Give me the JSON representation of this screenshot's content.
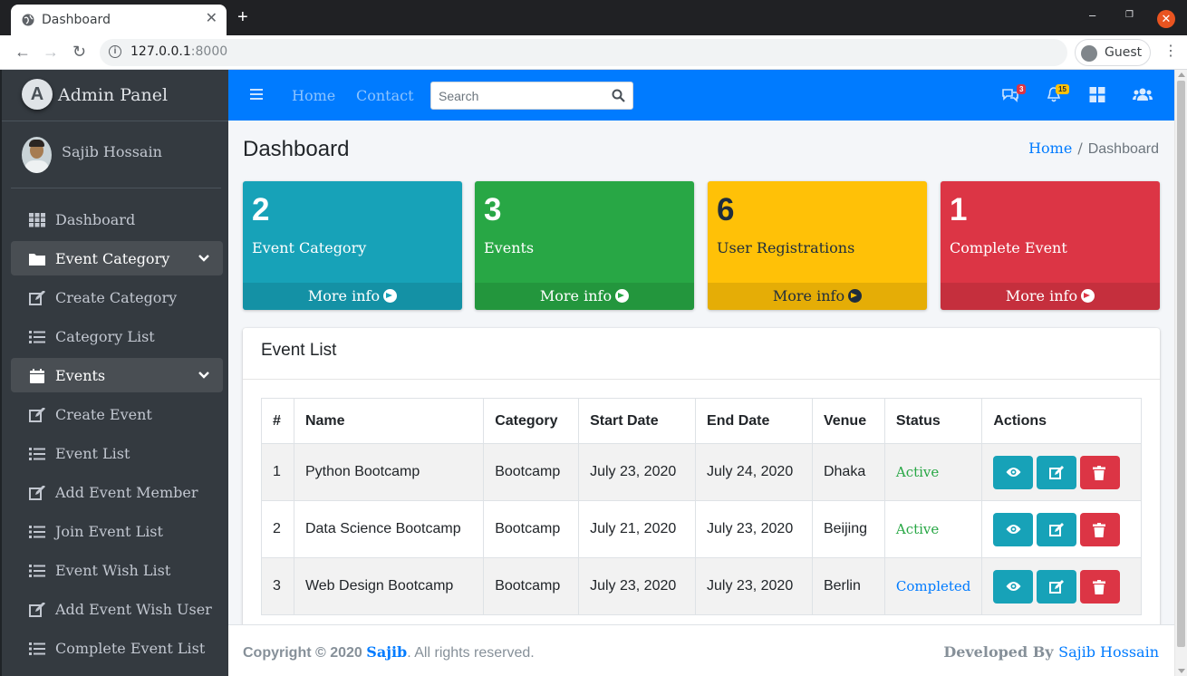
{
  "browser": {
    "tab_title": "Dashboard",
    "tab_close": "✕",
    "new_tab": "+",
    "url_host": "127.0.0.1",
    "url_port": ":8000",
    "profile_label": "Guest"
  },
  "sidebar": {
    "brand": "Admin Panel",
    "user_name": "Sajib Hossain",
    "items": [
      {
        "label": "Dashboard",
        "icon": "grid-icon"
      },
      {
        "label": "Event Category",
        "icon": "folder-icon",
        "expanded": true
      },
      {
        "label": "Create Category",
        "icon": "edit-icon"
      },
      {
        "label": "Category List",
        "icon": "list-icon"
      },
      {
        "label": "Events",
        "icon": "calendar-icon",
        "expanded": true
      },
      {
        "label": "Create Event",
        "icon": "edit-icon"
      },
      {
        "label": "Event List",
        "icon": "list-icon"
      },
      {
        "label": "Add Event Member",
        "icon": "edit-icon"
      },
      {
        "label": "Join Event List",
        "icon": "list-icon"
      },
      {
        "label": "Event Wish List",
        "icon": "list-icon"
      },
      {
        "label": "Add Event Wish User",
        "icon": "edit-icon"
      },
      {
        "label": "Complete Event List",
        "icon": "list-icon"
      }
    ]
  },
  "navbar": {
    "home": "Home",
    "contact": "Contact",
    "search_placeholder": "Search",
    "messages_count": "3",
    "notifications_count": "15"
  },
  "page": {
    "title": "Dashboard",
    "breadcrumb_home": "Home",
    "breadcrumb_sep": "/",
    "breadcrumb_current": "Dashboard"
  },
  "stats": [
    {
      "number": "2",
      "label": "Event Category",
      "more": "More info",
      "color": "#17a2b8"
    },
    {
      "number": "3",
      "label": "Events",
      "more": "More info",
      "color": "#28a745"
    },
    {
      "number": "6",
      "label": "User Registrations",
      "more": "More info",
      "color": "#ffc107"
    },
    {
      "number": "1",
      "label": "Complete Event",
      "more": "More info",
      "color": "#dc3545"
    }
  ],
  "event_list": {
    "title": "Event List",
    "headers": [
      "#",
      "Name",
      "Category",
      "Start Date",
      "End Date",
      "Venue",
      "Status",
      "Actions"
    ],
    "rows": [
      {
        "no": "1",
        "name": "Python Bootcamp",
        "category": "Bootcamp",
        "start": "July 23, 2020",
        "end": "July 24, 2020",
        "venue": "Dhaka",
        "status": "Active"
      },
      {
        "no": "2",
        "name": "Data Science Bootcamp",
        "category": "Bootcamp",
        "start": "July 21, 2020",
        "end": "July 23, 2020",
        "venue": "Beijing",
        "status": "Active"
      },
      {
        "no": "3",
        "name": "Web Design Bootcamp",
        "category": "Bootcamp",
        "start": "July 23, 2020",
        "end": "July 23, 2020",
        "venue": "Berlin",
        "status": "Completed"
      }
    ]
  },
  "footer": {
    "copyright": "Copyright © 2020 ",
    "brand": "Sajib",
    "rights": ". All rights reserved.",
    "developed_by": "Developed By ",
    "developer": "Sajib Hossain"
  }
}
